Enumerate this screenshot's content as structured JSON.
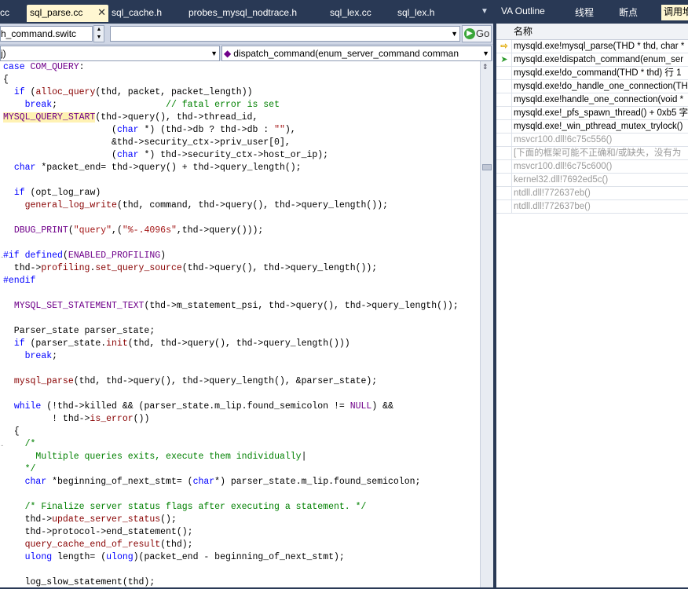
{
  "tabs": {
    "items": [
      {
        "label": "cc",
        "active": false
      },
      {
        "label": "sql_parse.cc",
        "active": true
      },
      {
        "label": "sql_cache.h",
        "active": false
      },
      {
        "label": "probes_mysql_nodtrace.h",
        "active": false
      },
      {
        "label": "sql_lex.cc",
        "active": false
      },
      {
        "label": "sql_lex.h",
        "active": false
      }
    ],
    "close_glyph": "✕",
    "scroll_glyph": "▼"
  },
  "right_tabs": {
    "items": [
      {
        "label": "VA Outline",
        "active": false
      },
      {
        "label": "线程",
        "active": false
      },
      {
        "label": "断点",
        "active": false
      },
      {
        "label": "调用堆",
        "active": true
      }
    ]
  },
  "toolbar": {
    "find_combo_value": "h_command.switc",
    "second_combo_value": "",
    "go_label": "Go"
  },
  "navbar": {
    "scope_value": "j)",
    "member_value": "dispatch_command(enum_server_command comman"
  },
  "editor": {
    "lines": [
      [
        [
          "case ",
          "kw"
        ],
        [
          "COM_QUERY",
          "mc"
        ],
        [
          ":",
          ""
        ]
      ],
      [
        [
          "{",
          ""
        ]
      ],
      [
        [
          "  ",
          ""
        ],
        [
          "if",
          "kw"
        ],
        [
          " (",
          ""
        ],
        [
          "alloc_query",
          "fn"
        ],
        [
          "(thd, packet, packet_length))",
          ""
        ]
      ],
      [
        [
          "    ",
          ""
        ],
        [
          "break",
          "kw"
        ],
        [
          ";                    ",
          ""
        ],
        [
          "// fatal error is set",
          "cm"
        ]
      ],
      [
        [
          "MYSQL_QUERY_START",
          "mc hl"
        ],
        [
          "(thd->query(), thd->thread_id,",
          ""
        ]
      ],
      [
        [
          "                    (",
          ""
        ],
        [
          "char",
          "kw"
        ],
        [
          " *) (thd->db ? thd->db : ",
          ""
        ],
        [
          "\"\"",
          "st"
        ],
        [
          "),",
          ""
        ]
      ],
      [
        [
          "                    &thd->security_ctx->priv_user[0],",
          ""
        ]
      ],
      [
        [
          "                    (",
          ""
        ],
        [
          "char",
          "kw"
        ],
        [
          " *) thd->security_ctx->host_or_ip);",
          ""
        ]
      ],
      [
        [
          "  ",
          ""
        ],
        [
          "char",
          "kw"
        ],
        [
          " *packet_end= thd->query() + thd->query_length();",
          ""
        ]
      ],
      [
        [
          "",
          ""
        ]
      ],
      [
        [
          "  ",
          ""
        ],
        [
          "if",
          "kw"
        ],
        [
          " (opt_log_raw)",
          ""
        ]
      ],
      [
        [
          "    ",
          ""
        ],
        [
          "general_log_write",
          "fn"
        ],
        [
          "(thd, command, thd->query(), thd->query_length());",
          ""
        ]
      ],
      [
        [
          "",
          ""
        ]
      ],
      [
        [
          "  ",
          ""
        ],
        [
          "DBUG_PRINT",
          "mc"
        ],
        [
          "(",
          ""
        ],
        [
          "\"query\"",
          "st"
        ],
        [
          ",(",
          ""
        ],
        [
          "\"%-.4096s\"",
          "st"
        ],
        [
          ",thd->query()));",
          ""
        ]
      ],
      [
        [
          "",
          ""
        ]
      ],
      [
        [
          "#if",
          "kw"
        ],
        [
          " ",
          ""
        ],
        [
          "defined",
          "kw"
        ],
        [
          "(",
          ""
        ],
        [
          "ENABLED_PROFILING",
          "mc"
        ],
        [
          ")",
          ""
        ]
      ],
      [
        [
          "  thd->",
          ""
        ],
        [
          "profiling",
          "fn"
        ],
        [
          ".",
          ""
        ],
        [
          "set_query_source",
          "fn"
        ],
        [
          "(thd->query(), thd->query_length());",
          ""
        ]
      ],
      [
        [
          "#endif",
          "kw"
        ]
      ],
      [
        [
          "",
          ""
        ]
      ],
      [
        [
          "  ",
          ""
        ],
        [
          "MYSQL_SET_STATEMENT_TEXT",
          "mc"
        ],
        [
          "(thd->m_statement_psi, thd->query(), thd->query_length());",
          ""
        ]
      ],
      [
        [
          "",
          ""
        ]
      ],
      [
        [
          "  Parser_state parser_state;",
          ""
        ]
      ],
      [
        [
          "  ",
          ""
        ],
        [
          "if",
          "kw"
        ],
        [
          " (parser_state.",
          ""
        ],
        [
          "init",
          "fn"
        ],
        [
          "(thd, thd->query(), thd->query_length()))",
          ""
        ]
      ],
      [
        [
          "    ",
          ""
        ],
        [
          "break",
          "kw"
        ],
        [
          ";",
          ""
        ]
      ],
      [
        [
          "",
          ""
        ]
      ],
      [
        [
          "  ",
          ""
        ],
        [
          "mysql_parse",
          "fn"
        ],
        [
          "(thd, thd->query(), thd->query_length(), &parser_state);",
          ""
        ]
      ],
      [
        [
          "",
          ""
        ]
      ],
      [
        [
          "  ",
          ""
        ],
        [
          "while",
          "kw"
        ],
        [
          " (!thd->killed && (parser_state.m_lip.found_semicolon != ",
          ""
        ],
        [
          "NULL",
          "mc"
        ],
        [
          ") &&",
          ""
        ]
      ],
      [
        [
          "         ! thd->",
          ""
        ],
        [
          "is_error",
          "fn"
        ],
        [
          "())",
          ""
        ]
      ],
      [
        [
          "  {",
          ""
        ]
      ],
      [
        [
          "    ",
          ""
        ],
        [
          "/*",
          "cm"
        ]
      ],
      [
        [
          "      ",
          ""
        ],
        [
          "Multiple queries exits, execute them individually",
          "cm"
        ],
        [
          "|",
          ""
        ]
      ],
      [
        [
          "    ",
          ""
        ],
        [
          "*/",
          "cm"
        ]
      ],
      [
        [
          "    ",
          ""
        ],
        [
          "char",
          "kw"
        ],
        [
          " *beginning_of_next_stmt= (",
          ""
        ],
        [
          "char",
          "kw"
        ],
        [
          "*) parser_state.m_lip.found_semicolon;",
          ""
        ]
      ],
      [
        [
          "",
          ""
        ]
      ],
      [
        [
          "    ",
          ""
        ],
        [
          "/* Finalize server status flags after executing a statement. */",
          "cm"
        ]
      ],
      [
        [
          "    thd->",
          ""
        ],
        [
          "update_server_status",
          "fn"
        ],
        [
          "();",
          ""
        ]
      ],
      [
        [
          "    thd->protocol->end_statement();",
          ""
        ]
      ],
      [
        [
          "    ",
          ""
        ],
        [
          "query_cache_end_of_result",
          "fn"
        ],
        [
          "(thd);",
          ""
        ]
      ],
      [
        [
          "    ",
          ""
        ],
        [
          "ulong",
          "kw"
        ],
        [
          " length= (",
          ""
        ],
        [
          "ulong",
          "kw"
        ],
        [
          ")(packet_end - beginning_of_next_stmt);",
          ""
        ]
      ],
      [
        [
          "",
          ""
        ]
      ],
      [
        [
          "    log_slow_statement(thd);",
          ""
        ]
      ]
    ]
  },
  "call_stack": {
    "header": "名称",
    "rows": [
      {
        "text": "mysqld.exe!mysql_parse(THD * thd, char *",
        "icon": "current-frame-arrow-icon",
        "gray": false
      },
      {
        "text": "mysqld.exe!dispatch_command(enum_ser",
        "icon": "caller-frame-arrow-icon",
        "gray": false
      },
      {
        "text": "mysqld.exe!do_command(THD * thd)  行 1",
        "icon": "",
        "gray": false
      },
      {
        "text": "mysqld.exe!do_handle_one_connection(TH",
        "icon": "",
        "gray": false
      },
      {
        "text": "mysqld.exe!handle_one_connection(void *",
        "icon": "",
        "gray": false
      },
      {
        "text": "mysqld.exe!_pfs_spawn_thread()  + 0xb5 字",
        "icon": "",
        "gray": false
      },
      {
        "text": "mysqld.exe!_win_pthread_mutex_trylock()",
        "icon": "",
        "gray": false
      },
      {
        "text": "msvcr100.dll!6c75c556()",
        "icon": "",
        "gray": true
      },
      {
        "text": "[下面的框架可能不正确和/或缺失，没有为",
        "icon": "",
        "gray": true
      },
      {
        "text": "msvcr100.dll!6c75c600()",
        "icon": "",
        "gray": true
      },
      {
        "text": "kernel32.dll!7692ed5c()",
        "icon": "",
        "gray": true
      },
      {
        "text": "ntdll.dll!772637eb()",
        "icon": "",
        "gray": true
      },
      {
        "text": "ntdll.dll!772637be()",
        "icon": "",
        "gray": true
      }
    ]
  },
  "colors": {
    "chrome": "#293955",
    "active_tab": "#fff7d2",
    "keyword": "#0000ff",
    "comment": "#008000",
    "macro": "#6f008a"
  }
}
